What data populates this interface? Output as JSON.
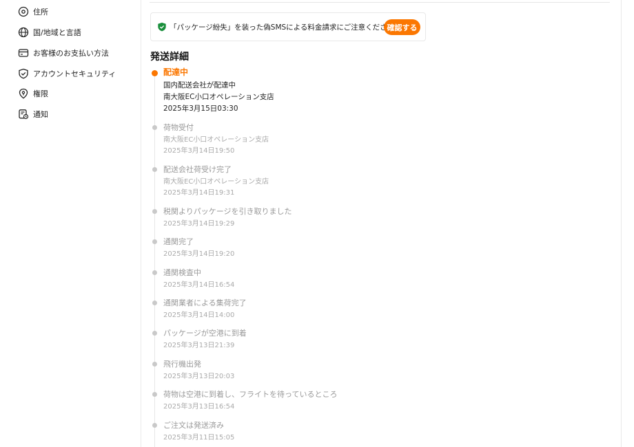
{
  "sidebar": {
    "items": [
      {
        "label": "住所",
        "icon": "location-pin-icon"
      },
      {
        "label": "国/地域と言語",
        "icon": "globe-icon"
      },
      {
        "label": "お客様のお支払い方法",
        "icon": "credit-card-icon"
      },
      {
        "label": "アカウントセキュリティ",
        "icon": "shield-check-icon"
      },
      {
        "label": "権限",
        "icon": "permission-shield-icon"
      },
      {
        "label": "通知",
        "icon": "notification-icon"
      }
    ]
  },
  "notice": {
    "message": "「パッケージ紛失」を装った偽SMSによる料金請求にご注意ください。",
    "button_label": "確認する",
    "icon": "shield-check-icon",
    "accent_color": "#fb7701",
    "shield_color": "#1a8f3c"
  },
  "shipping": {
    "title": "発送詳細",
    "events": [
      {
        "status": "配達中",
        "lines": [
          "国内配送会社が配達中",
          "南大阪EC小口オペレーション支店",
          "2025年3月15日03:30"
        ]
      },
      {
        "status": "荷物受付",
        "lines": [
          "南大阪EC小口オペレーション支店",
          "2025年3月14日19:50"
        ]
      },
      {
        "status": "配送会社荷受け完了",
        "lines": [
          "南大阪EC小口オペレーション支店",
          "2025年3月14日19:31"
        ]
      },
      {
        "status": "税関よりパッケージを引き取りました",
        "lines": [
          "2025年3月14日19:29"
        ]
      },
      {
        "status": "通関完了",
        "lines": [
          "2025年3月14日19:20"
        ]
      },
      {
        "status": "通関検査中",
        "lines": [
          "2025年3月14日16:54"
        ]
      },
      {
        "status": "通関業者による集荷完了",
        "lines": [
          "2025年3月14日14:00"
        ]
      },
      {
        "status": "パッケージが空港に到着",
        "lines": [
          "2025年3月13日21:39"
        ]
      },
      {
        "status": "飛行機出発",
        "lines": [
          "2025年3月13日20:03"
        ]
      },
      {
        "status": "荷物は空港に到着し、フライトを待っているところ",
        "lines": [
          "2025年3月13日16:54"
        ]
      },
      {
        "status": "ご注文は発送済み",
        "lines": [
          "2025年3月11日15:05"
        ]
      }
    ]
  }
}
